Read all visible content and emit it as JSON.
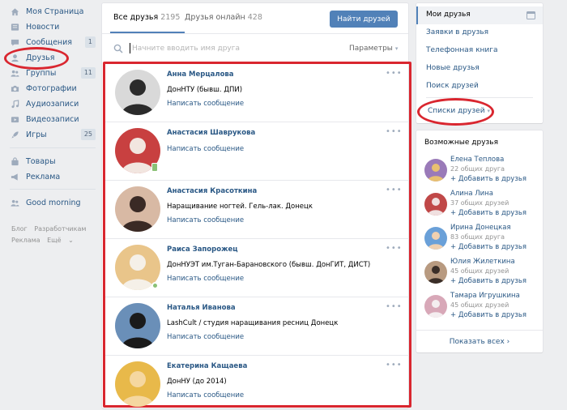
{
  "left_nav": {
    "items": [
      {
        "label": "Моя Страница",
        "icon": "home-icon",
        "badge": ""
      },
      {
        "label": "Новости",
        "icon": "news-icon",
        "badge": ""
      },
      {
        "label": "Сообщения",
        "icon": "chat-icon",
        "badge": "1"
      },
      {
        "label": "Друзья",
        "icon": "user-icon",
        "badge": ""
      },
      {
        "label": "Группы",
        "icon": "group-icon",
        "badge": "11"
      },
      {
        "label": "Фотографии",
        "icon": "camera-icon",
        "badge": ""
      },
      {
        "label": "Аудиозаписи",
        "icon": "music-icon",
        "badge": ""
      },
      {
        "label": "Видеозаписи",
        "icon": "video-icon",
        "badge": ""
      },
      {
        "label": "Игры",
        "icon": "rocket-icon",
        "badge": "25"
      }
    ],
    "items2": [
      {
        "label": "Товары",
        "icon": "bag-icon"
      },
      {
        "label": "Реклама",
        "icon": "megaphone-icon"
      }
    ],
    "extra": {
      "label": "Good morning",
      "icon": "group-icon"
    },
    "footer": {
      "blog": "Блог",
      "developers": "Разработчикам",
      "ads": "Реклама",
      "more": "Ещё"
    }
  },
  "main": {
    "tab_all_label": "Все друзья",
    "tab_all_count": "2195",
    "tab_online_label": "Друзья онлайн",
    "tab_online_count": "428",
    "find_button": "Найти друзей",
    "search_placeholder": "Начните вводить имя друга",
    "params_label": "Параметры",
    "friends": [
      {
        "name": "Анна Мерцалова",
        "sub": "ДонНТУ (бывш. ДПИ)",
        "msg": "Написать сообщение",
        "status": "",
        "colors": [
          "#d9d9d9",
          "#2b2b2b"
        ]
      },
      {
        "name": "Анастасия Шаврукова",
        "sub": "",
        "msg": "Написать сообщение",
        "status": "mobile",
        "colors": [
          "#c84040",
          "#f2e6e0"
        ]
      },
      {
        "name": "Анастасия Красоткина",
        "sub": "Наращивание ногтей. Гель-лак. Донецк",
        "msg": "Написать сообщение",
        "status": "",
        "colors": [
          "#d8b9a4",
          "#3a2a25"
        ]
      },
      {
        "name": "Раиса Запорожец",
        "sub": "ДонНУЭТ им.Туган-Барановского (бывш. ДонГИТ, ДИСТ)",
        "msg": "Написать сообщение",
        "status": "online",
        "colors": [
          "#e9c58a",
          "#f5f0e8"
        ]
      },
      {
        "name": "Наталья Иванова",
        "sub": "LashCult / студия наращивания ресниц Донецк",
        "msg": "Написать сообщение",
        "status": "",
        "colors": [
          "#6a8fb8",
          "#1a1a1a"
        ]
      },
      {
        "name": "Екатерина Кащаева",
        "sub": "ДонНУ (до 2014)",
        "msg": "Написать сообщение",
        "status": "",
        "colors": [
          "#e8b94a",
          "#f5d7a0"
        ]
      }
    ]
  },
  "right_menu": {
    "items": [
      "Мои друзья",
      "Заявки в друзья",
      "Телефонная книга",
      "Новые друзья",
      "Поиск друзей"
    ],
    "lists_label": "Списки друзей"
  },
  "possible": {
    "header": "Возможные друзья",
    "add_label": "+ Добавить в друзья",
    "people": [
      {
        "name": "Елена Теплова",
        "mutual": "22 общих друга",
        "colors": [
          "#9a7ab8",
          "#e8c070"
        ]
      },
      {
        "name": "Алина Лина",
        "mutual": "37 общих друзей",
        "colors": [
          "#c04848",
          "#f0e0e0"
        ]
      },
      {
        "name": "Ирина Донецкая",
        "mutual": "83 общих друга",
        "colors": [
          "#6aa0d8",
          "#f0d0b0"
        ]
      },
      {
        "name": "Юлия Жилеткина",
        "mutual": "45 общих друзей",
        "colors": [
          "#b89a80",
          "#3a2e28"
        ]
      },
      {
        "name": "Тамара Игрушкина",
        "mutual": "45 общих друзей",
        "colors": [
          "#d8a8b8",
          "#f4eef0"
        ]
      }
    ],
    "show_all": "Показать всех"
  },
  "colors": {
    "link": "#2a5885",
    "accent": "#5181b8",
    "highlight": "#d9262f",
    "online": "#8ac176"
  }
}
